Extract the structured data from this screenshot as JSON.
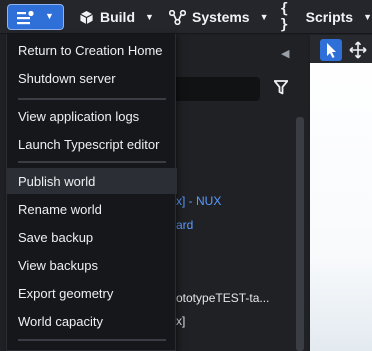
{
  "toolbar": {
    "build_label": "Build",
    "systems_label": "Systems",
    "scripts_label": "Scripts",
    "scripts_icon": "{ }",
    "caret": "▼"
  },
  "panel": {
    "lines": [
      "x]  -  NUX",
      "ard",
      "ototypeTEST-ta...",
      "x]"
    ]
  },
  "menu": {
    "items": [
      "Return to Creation Home",
      "Shutdown server",
      "View application logs",
      "Launch Typescript editor",
      "Publish world",
      "Rename world",
      "Save backup",
      "View backups",
      "Export geometry",
      "World capacity"
    ]
  },
  "colors": {
    "accent": "#2f6fd8",
    "link_blue": "#5b9bff",
    "menu_bg": "#15171a"
  },
  "icons": [
    "menu-icon",
    "cube-icon",
    "systems-icon",
    "filter-icon",
    "pointer-icon",
    "move-icon",
    "collapse-left-icon"
  ]
}
